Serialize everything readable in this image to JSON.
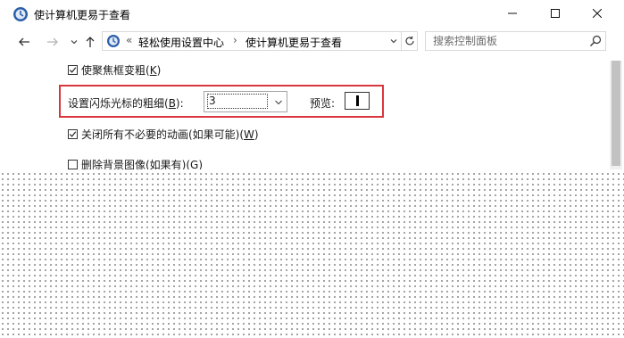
{
  "window": {
    "title": "使计算机更易于查看",
    "controls": {
      "minimize": "minimize",
      "maximize": "maximize",
      "close": "close"
    }
  },
  "nav": {
    "address": {
      "chevron": "«",
      "breadcrumbs": [
        {
          "label": "轻松使用设置中心"
        },
        {
          "label": "使计算机更易于查看"
        }
      ],
      "separator": "›"
    },
    "search": {
      "placeholder": "搜索控制面板",
      "value": ""
    }
  },
  "options": {
    "focus_rect": {
      "text": "使聚焦框变粗(",
      "key": "K",
      "end": ")",
      "checked": true
    },
    "cursor_thickness": {
      "label_text": "设置闪烁光标的粗细(",
      "label_key": "B",
      "label_end": "):",
      "value": "3",
      "preview_label": "预览:"
    },
    "animations": {
      "text": "关闭所有不必要的动画(如果可能)(",
      "key": "W",
      "end": ")",
      "checked": true
    },
    "background": {
      "text": "删除背景图像(如果有)(",
      "key": "G",
      "end": ")",
      "checked": false
    }
  },
  "colors": {
    "highlight": "#d9363e",
    "accent": "#1f5fb6"
  }
}
